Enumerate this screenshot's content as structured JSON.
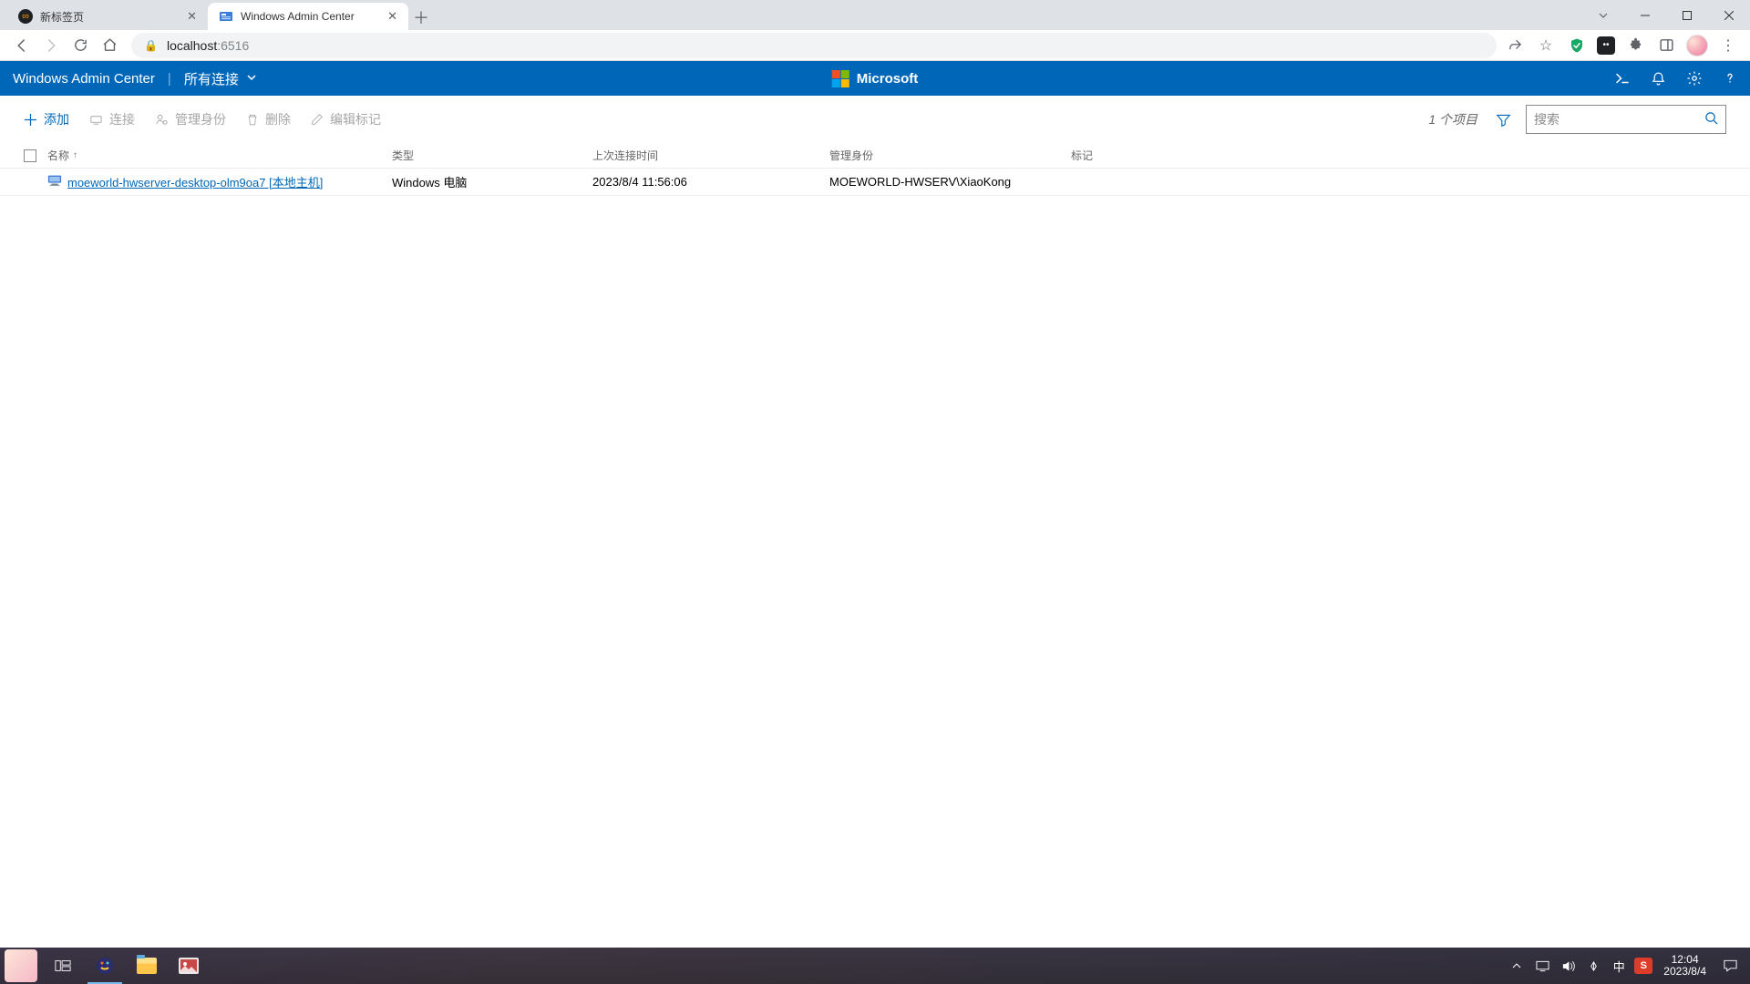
{
  "browser": {
    "tabs": [
      {
        "title": "新标签页",
        "active": false
      },
      {
        "title": "Windows Admin Center",
        "active": true
      }
    ],
    "url_host": "localhost",
    "url_port": ":6516"
  },
  "wac_header": {
    "title": "Windows Admin Center",
    "breadcrumb": "所有连接",
    "microsoft_label": "Microsoft"
  },
  "toolbar": {
    "add": "添加",
    "connect": "连接",
    "manage_identity": "管理身份",
    "delete": "删除",
    "edit_tags": "编辑标记",
    "item_count": "1 个项目",
    "search_placeholder": "搜索"
  },
  "table": {
    "headers": {
      "name": "名称",
      "type": "类型",
      "last_connection": "上次连接时间",
      "identity": "管理身份",
      "tags": "标记"
    },
    "rows": [
      {
        "name": "moeworld-hwserver-desktop-olm9oa7 [本地主机]",
        "type": "Windows 电脑",
        "last_connection": "2023/8/4 11:56:06",
        "identity": "MOEWORLD-HWSERV\\XiaoKong",
        "tags": ""
      }
    ]
  },
  "taskbar": {
    "ime": "中",
    "ime_badge": "S",
    "clock_time": "12:04",
    "clock_date": "2023/8/4"
  }
}
